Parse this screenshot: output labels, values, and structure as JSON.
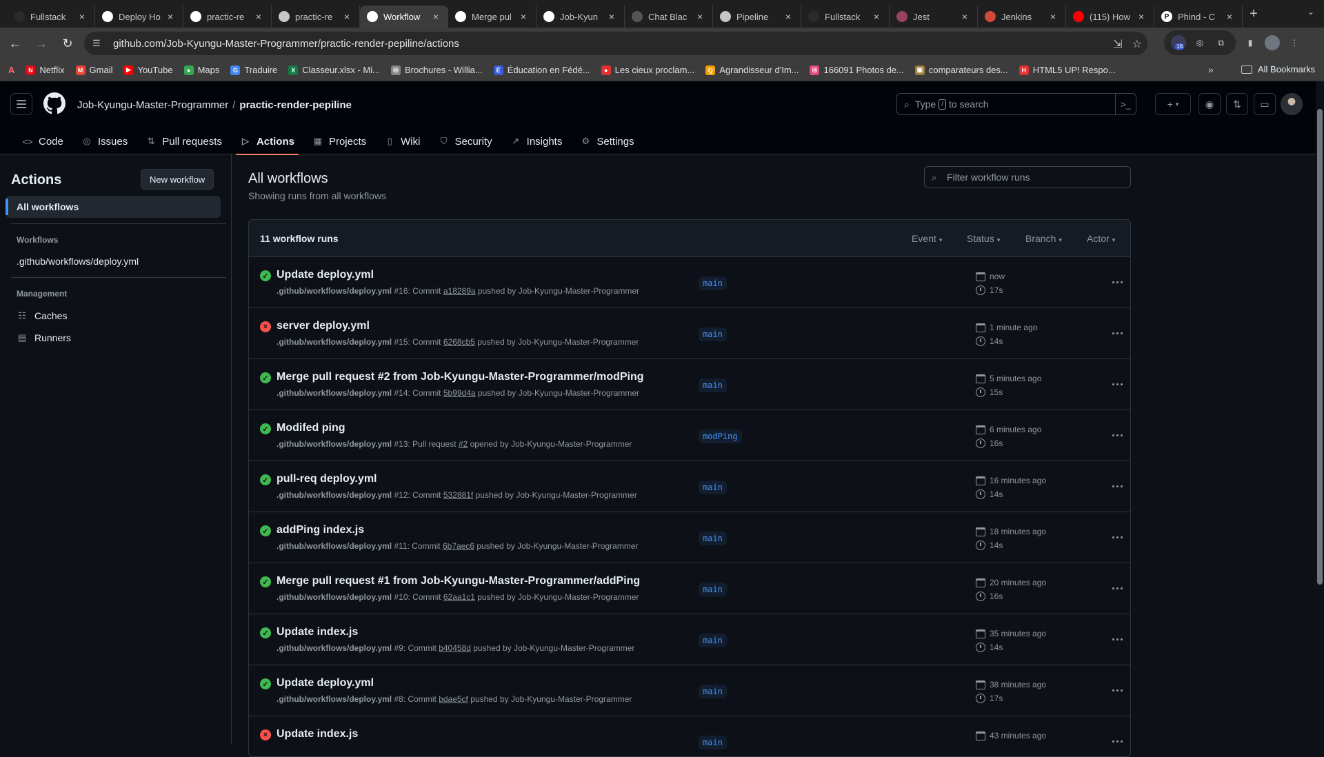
{
  "browser": {
    "tabs": [
      {
        "label": "Fullstack",
        "favicon_color": "#2b2b2b",
        "glyph": ""
      },
      {
        "label": "Deploy Ho",
        "favicon_color": "#ffffff",
        "glyph": ""
      },
      {
        "label": "practic-re",
        "favicon_color": "#ffffff",
        "glyph": ""
      },
      {
        "label": "practic-re",
        "favicon_color": "#c4c7c5",
        "glyph": ""
      },
      {
        "label": "Workflow",
        "favicon_color": "#ffffff",
        "glyph": ""
      },
      {
        "label": "Merge pul",
        "favicon_color": "#ffffff",
        "glyph": ""
      },
      {
        "label": "Job-Kyun",
        "favicon_color": "#ffffff",
        "glyph": ""
      },
      {
        "label": "Chat Blac",
        "favicon_color": "#555555",
        "glyph": ""
      },
      {
        "label": "Pipeline",
        "favicon_color": "#c4c7c5",
        "glyph": ""
      },
      {
        "label": "Fullstack",
        "favicon_color": "#2b2b2b",
        "glyph": ""
      },
      {
        "label": "Jest",
        "favicon_color": "#99425b",
        "glyph": ""
      },
      {
        "label": "Jenkins",
        "favicon_color": "#d24939",
        "glyph": ""
      },
      {
        "label": "(115) How",
        "favicon_color": "#ff0000",
        "glyph": ""
      },
      {
        "label": "Phind - C",
        "favicon_color": "#ffffff",
        "glyph": "P"
      }
    ],
    "url": "github.com/Job-Kyungu-Master-Programmer/practic-render-pepiline/actions",
    "extension_badge": "16",
    "bookmarks": [
      {
        "label": "Netflix",
        "color": "#e50914",
        "glyph": "N"
      },
      {
        "label": "Gmail",
        "color": "#ea4335",
        "glyph": "M"
      },
      {
        "label": "YouTube",
        "color": "#ff0000",
        "glyph": "▶"
      },
      {
        "label": "Maps",
        "color": "#34a853",
        "glyph": "●"
      },
      {
        "label": "Traduire",
        "color": "#4285f4",
        "glyph": "G"
      },
      {
        "label": "Classeur.xlsx - Mi...",
        "color": "#107c41",
        "glyph": "X"
      },
      {
        "label": "Brochures - Willia...",
        "color": "#888888",
        "glyph": "◎"
      },
      {
        "label": "Éducation en Fédé...",
        "color": "#3b5bdb",
        "glyph": "É"
      },
      {
        "label": "Les cieux proclam...",
        "color": "#e03131",
        "glyph": "●"
      },
      {
        "label": "Agrandisseur d'Im...",
        "color": "#f59f00",
        "glyph": "Q"
      },
      {
        "label": "166091 Photos de...",
        "color": "#e64980",
        "glyph": "◎"
      },
      {
        "label": "comparateurs des...",
        "color": "#a08040",
        "glyph": "▣"
      },
      {
        "label": "HTML5 UP! Respo...",
        "color": "#e03131",
        "glyph": "H"
      }
    ],
    "all_bookmarks": "All Bookmarks"
  },
  "github": {
    "owner": "Job-Kyungu-Master-Programmer",
    "repo": "practic-render-pepiline",
    "search_prefix": "Type",
    "search_key": "/",
    "search_suffix": "to search",
    "nav": [
      {
        "label": "Code",
        "icon": "code-icon",
        "glyph": "<>"
      },
      {
        "label": "Issues",
        "icon": "issue-icon",
        "glyph": "◎"
      },
      {
        "label": "Pull requests",
        "icon": "pull-request-icon",
        "glyph": "⇅"
      },
      {
        "label": "Actions",
        "icon": "play-icon",
        "glyph": "▷",
        "active": true
      },
      {
        "label": "Projects",
        "icon": "table-icon",
        "glyph": "▦"
      },
      {
        "label": "Wiki",
        "icon": "book-icon",
        "glyph": "▯"
      },
      {
        "label": "Security",
        "icon": "shield-icon",
        "glyph": "⛉"
      },
      {
        "label": "Insights",
        "icon": "graph-icon",
        "glyph": "↗"
      },
      {
        "label": "Settings",
        "icon": "gear-icon",
        "glyph": "⚙"
      }
    ]
  },
  "sidebar": {
    "title": "Actions",
    "new_workflow": "New workflow",
    "all_workflows": "All workflows",
    "workflows_heading": "Workflows",
    "workflow_file": ".github/workflows/deploy.yml",
    "management_heading": "Management",
    "caches": "Caches",
    "runners": "Runners"
  },
  "main": {
    "title": "All workflows",
    "subtitle": "Showing runs from all workflows",
    "filter_placeholder": "Filter workflow runs",
    "run_count": "11 workflow runs",
    "filters": [
      "Event",
      "Status",
      "Branch",
      "Actor"
    ],
    "status_colors": {
      "success": "#3fb950",
      "failure": "#f85149"
    },
    "runs": [
      {
        "title": "Update deploy.yml",
        "status": "success",
        "workflow": ".github/workflows/deploy.yml",
        "number": "#16",
        "kind": "Commit",
        "ref": "a18289a",
        "verb": "pushed by",
        "actor": "Job-Kyungu-Master-Programmer",
        "branch": "main",
        "when": "now",
        "duration": "17s"
      },
      {
        "title": "server deploy.yml",
        "status": "failure",
        "workflow": ".github/workflows/deploy.yml",
        "number": "#15",
        "kind": "Commit",
        "ref": "6268cb5",
        "verb": "pushed by",
        "actor": "Job-Kyungu-Master-Programmer",
        "branch": "main",
        "when": "1 minute ago",
        "duration": "14s"
      },
      {
        "title": "Merge pull request #2 from Job-Kyungu-Master-Programmer/modPing",
        "status": "success",
        "workflow": ".github/workflows/deploy.yml",
        "number": "#14",
        "kind": "Commit",
        "ref": "5b99d4a",
        "verb": "pushed by",
        "actor": "Job-Kyungu-Master-Programmer",
        "branch": "main",
        "when": "5 minutes ago",
        "duration": "15s"
      },
      {
        "title": "Modifed ping",
        "status": "success",
        "workflow": ".github/workflows/deploy.yml",
        "number": "#13",
        "kind": "Pull request",
        "ref": "#2",
        "verb": "opened by",
        "actor": "Job-Kyungu-Master-Programmer",
        "branch": "modPing",
        "when": "6 minutes ago",
        "duration": "16s"
      },
      {
        "title": "pull-req deploy.yml",
        "status": "success",
        "workflow": ".github/workflows/deploy.yml",
        "number": "#12",
        "kind": "Commit",
        "ref": "532881f",
        "verb": "pushed by",
        "actor": "Job-Kyungu-Master-Programmer",
        "branch": "main",
        "when": "16 minutes ago",
        "duration": "14s"
      },
      {
        "title": "addPing index.js",
        "status": "success",
        "workflow": ".github/workflows/deploy.yml",
        "number": "#11",
        "kind": "Commit",
        "ref": "6b7aec6",
        "verb": "pushed by",
        "actor": "Job-Kyungu-Master-Programmer",
        "branch": "main",
        "when": "18 minutes ago",
        "duration": "14s"
      },
      {
        "title": "Merge pull request #1 from Job-Kyungu-Master-Programmer/addPing",
        "status": "success",
        "workflow": ".github/workflows/deploy.yml",
        "number": "#10",
        "kind": "Commit",
        "ref": "62aa1c1",
        "verb": "pushed by",
        "actor": "Job-Kyungu-Master-Programmer",
        "branch": "main",
        "when": "20 minutes ago",
        "duration": "16s"
      },
      {
        "title": "Update index.js",
        "status": "success",
        "workflow": ".github/workflows/deploy.yml",
        "number": "#9",
        "kind": "Commit",
        "ref": "b40458d",
        "verb": "pushed by",
        "actor": "Job-Kyungu-Master-Programmer",
        "branch": "main",
        "when": "35 minutes ago",
        "duration": "14s"
      },
      {
        "title": "Update deploy.yml",
        "status": "success",
        "workflow": ".github/workflows/deploy.yml",
        "number": "#8",
        "kind": "Commit",
        "ref": "bdae5cf",
        "verb": "pushed by",
        "actor": "Job-Kyungu-Master-Programmer",
        "branch": "main",
        "when": "38 minutes ago",
        "duration": "17s"
      },
      {
        "title": "Update index.js",
        "status": "failure",
        "workflow": "",
        "number": "",
        "kind": "",
        "ref": "",
        "verb": "",
        "actor": "",
        "branch": "main",
        "when": "43 minutes ago",
        "duration": ""
      }
    ]
  }
}
